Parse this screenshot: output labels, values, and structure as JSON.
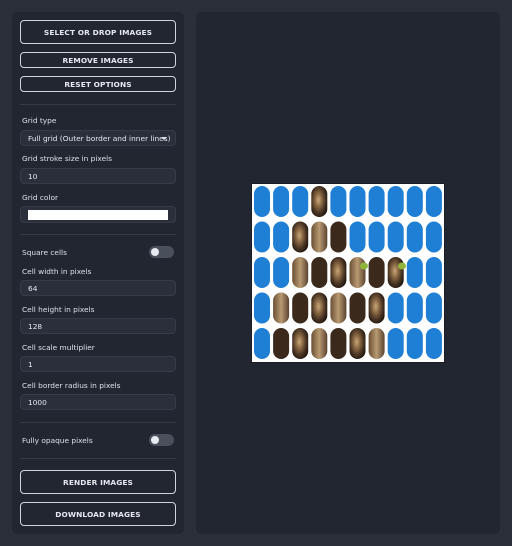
{
  "buttons": {
    "select": "SELECT OR DROP IMAGES",
    "remove": "REMOVE IMAGES",
    "reset": "RESET OPTIONS",
    "render": "RENDER IMAGES",
    "download": "DOWNLOAD IMAGES"
  },
  "grid": {
    "type_label": "Grid type",
    "type_value": "Full grid (Outer border and inner lines)",
    "stroke_label": "Grid stroke size in pixels",
    "stroke_value": "10",
    "color_label": "Grid color",
    "color_value": "#ffffff"
  },
  "cells": {
    "square_label": "Square cells",
    "square_on": false,
    "width_label": "Cell width in pixels",
    "width_value": "64",
    "height_label": "Cell height in pixels",
    "height_value": "128",
    "scale_label": "Cell scale multiplier",
    "scale_value": "1",
    "radius_label": "Cell border radius in pixels",
    "radius_value": "1000"
  },
  "opaque": {
    "label": "Fully opaque pixels",
    "on": false
  },
  "colors": {
    "cell_blue": "#1f7fd4",
    "background": "#2b2f3a",
    "panel": "#222631"
  }
}
